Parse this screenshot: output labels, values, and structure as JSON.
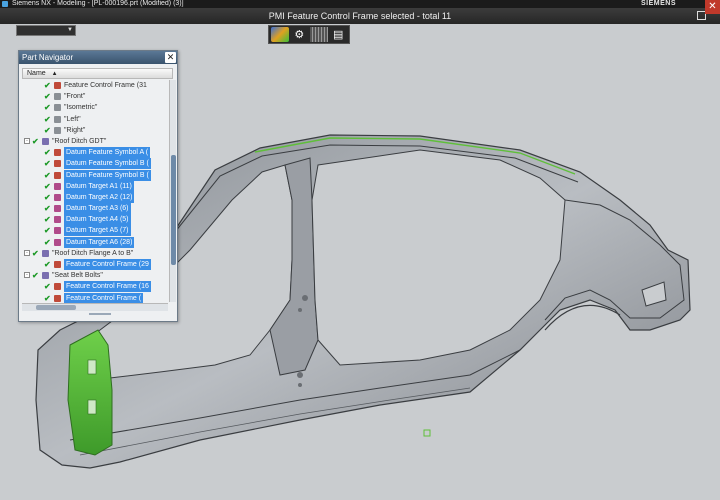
{
  "window": {
    "title": "Siemens NX - Modeling - [PL-000196.prt (Modified)    (3)]",
    "brand": "SIEMENS",
    "close_glyph": "✕"
  },
  "status": {
    "text": "PMI Feature Control Frame selected - total 11"
  },
  "toolbar": {
    "icons": [
      "selection-filter-icon",
      "settings-gear-icon",
      "grid-icon",
      "dropdown-menu-icon"
    ]
  },
  "navigator": {
    "title": "Part Navigator",
    "close_glyph": "✕",
    "column_name": "Name",
    "sort_glyph": "▲",
    "rows": [
      {
        "label": "Feature Control Frame (31",
        "indent": 2,
        "icon": "pmi-icon",
        "selected": false
      },
      {
        "label": "\"Front\"",
        "indent": 2,
        "icon": "view-icon",
        "selected": false
      },
      {
        "label": "\"Isometric\"",
        "indent": 2,
        "icon": "view-icon",
        "selected": false
      },
      {
        "label": "\"Left\"",
        "indent": 2,
        "icon": "view-icon",
        "selected": false
      },
      {
        "label": "\"Right\"",
        "indent": 2,
        "icon": "view-icon",
        "selected": false
      },
      {
        "label": "\"Roof Ditch GDT\"",
        "indent": 1,
        "icon": "group-icon",
        "selected": false,
        "expander": "-"
      },
      {
        "label": "Datum Feature Symbol A (",
        "indent": 2,
        "icon": "datum-icon",
        "selected": true
      },
      {
        "label": "Datum Feature Symbol B (",
        "indent": 2,
        "icon": "datum-icon",
        "selected": true
      },
      {
        "label": "Datum Feature Symbol B (",
        "indent": 2,
        "icon": "datum-icon",
        "selected": true
      },
      {
        "label": "Datum Target A1 (11)",
        "indent": 2,
        "icon": "target-icon",
        "selected": true
      },
      {
        "label": "Datum Target A2 (12)",
        "indent": 2,
        "icon": "target-icon",
        "selected": true
      },
      {
        "label": "Datum Target A3 (6)",
        "indent": 2,
        "icon": "target-icon",
        "selected": true
      },
      {
        "label": "Datum Target A4 (5)",
        "indent": 2,
        "icon": "target-icon",
        "selected": true
      },
      {
        "label": "Datum Target A5 (7)",
        "indent": 2,
        "icon": "target-icon",
        "selected": true
      },
      {
        "label": "Datum Target A6 (28)",
        "indent": 2,
        "icon": "target-icon",
        "selected": true
      },
      {
        "label": "\"Roof Ditch Flange A to B\"",
        "indent": 1,
        "icon": "group-icon",
        "selected": false,
        "expander": "-"
      },
      {
        "label": "Feature Control Frame (29",
        "indent": 2,
        "icon": "pmi-icon",
        "selected": true
      },
      {
        "label": "\"Seat Belt Bolts\"",
        "indent": 1,
        "icon": "group-icon",
        "selected": false,
        "expander": "-"
      },
      {
        "label": "Feature Control Frame (16",
        "indent": 2,
        "icon": "pmi-icon",
        "selected": true
      },
      {
        "label": "Feature Control Frame (",
        "indent": 2,
        "icon": "pmi-icon",
        "selected": true
      }
    ]
  },
  "colors": {
    "selection": "#3a8ee6",
    "check": "#1f9a2a",
    "highlight_green": "#5fbf3a",
    "viewport_bg": "#c9cccf"
  }
}
